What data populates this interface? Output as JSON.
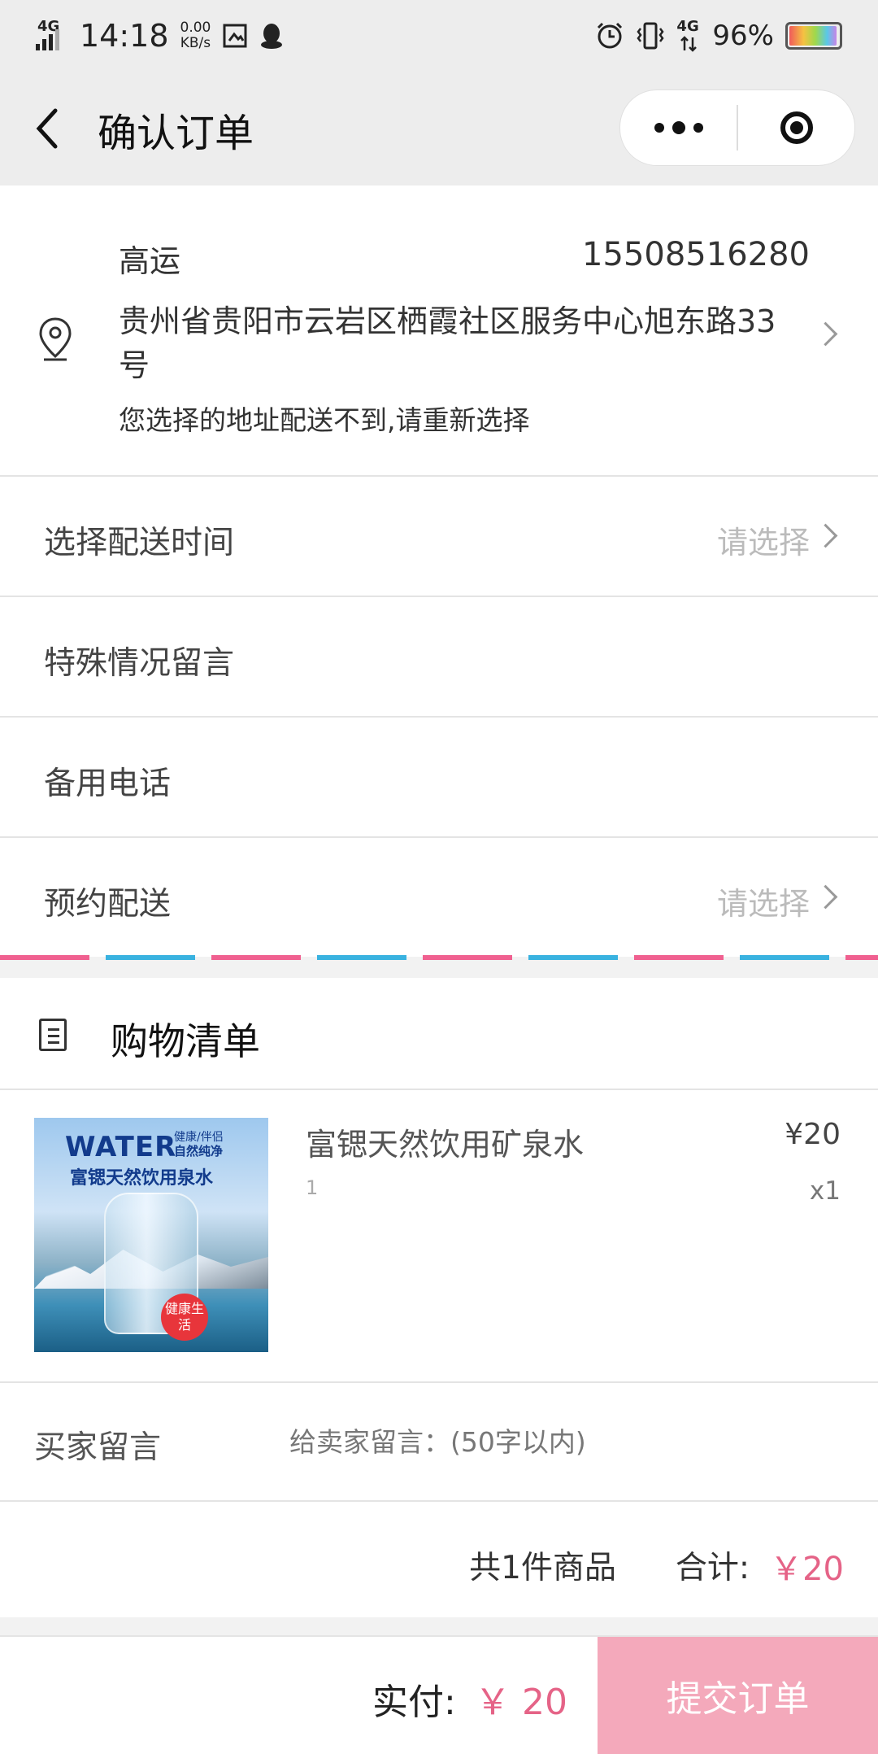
{
  "status_bar": {
    "network": "4G",
    "time": "14:18",
    "speed_value": "0.00",
    "speed_unit": "KB/s",
    "network_right": "4G",
    "battery": "96%",
    "icons": [
      "signal-icon",
      "screenshot-icon",
      "qq-icon",
      "alarm-icon",
      "vibrate-icon",
      "battery-icon"
    ]
  },
  "nav": {
    "title": "确认订单"
  },
  "address": {
    "name": "高运",
    "phone": "15508516280",
    "line": "贵州省贵阳市云岩区栖霞社区服务中心旭东路33号",
    "warning": "您选择的地址配送不到,请重新选择"
  },
  "rows": {
    "delivery_time": {
      "label": "选择配送时间",
      "hint": "请选择"
    },
    "special_note": {
      "label": "特殊情况留言"
    },
    "backup_phone": {
      "label": "备用电话"
    },
    "scheduled": {
      "label": "预约配送",
      "hint": "请选择"
    }
  },
  "cart": {
    "title": "购物清单",
    "item": {
      "name": "富锶天然饮用矿泉水",
      "spec": "1",
      "price": "¥20",
      "qty": "x1",
      "image_text": {
        "headline": "WATER",
        "tags": "健康/伴侣",
        "tagline_1": "自然纯净",
        "subtitle": "富锶天然饮用泉水",
        "badge": "健康生活"
      }
    }
  },
  "buyer_msg": {
    "label": "买家留言",
    "placeholder": "给卖家留言：(50字以内)"
  },
  "summary": {
    "count": "共1件商品",
    "total_label": "合计:",
    "total_amount": "￥20"
  },
  "bottom": {
    "pay_label": "实付:",
    "pay_amount": "￥ 20",
    "submit_label": "提交订单"
  },
  "colors": {
    "accent": "#e56387",
    "submit_bg": "#f4a9bb"
  }
}
